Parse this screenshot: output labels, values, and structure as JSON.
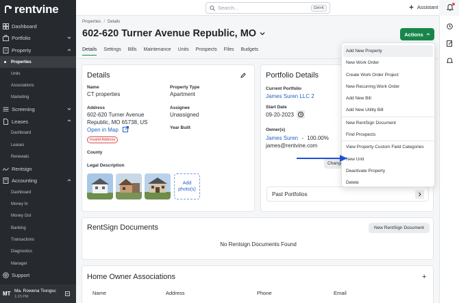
{
  "app": {
    "logo_text": "rentvine"
  },
  "sidebar": {
    "items": [
      {
        "label": "Dashboard",
        "icon": "dashboard-icon"
      },
      {
        "label": "Portfolio",
        "icon": "briefcase-icon"
      },
      {
        "label": "Property",
        "icon": "building-icon"
      },
      {
        "label": "Properties"
      },
      {
        "label": "Units"
      },
      {
        "label": "Associations"
      },
      {
        "label": "Marketing"
      },
      {
        "label": "Screening",
        "icon": "screening-icon"
      },
      {
        "label": "Leases",
        "icon": "document-icon"
      },
      {
        "label": "Dashboard"
      },
      {
        "label": "Leases"
      },
      {
        "label": "Renewals"
      },
      {
        "label": "Rentsign",
        "icon": "signature-icon"
      },
      {
        "label": "Accounting",
        "icon": "calculator-icon"
      },
      {
        "label": "Dashboard"
      },
      {
        "label": "Money In"
      },
      {
        "label": "Money Out"
      },
      {
        "label": "Banking"
      },
      {
        "label": "Transactions"
      },
      {
        "label": "Diagnostics"
      },
      {
        "label": "Manager"
      },
      {
        "label": "Support",
        "icon": "support-icon"
      }
    ],
    "user": {
      "initials": "MT",
      "name": "Ma. Rowena Tiongsc",
      "time": "1:23 PM"
    }
  },
  "topbar": {
    "search_placeholder": "Search...",
    "shortcut": "Ctrl+K",
    "assistant_label": "Assistant"
  },
  "breadcrumb": {
    "root": "Properties",
    "sep": "/",
    "current": "Details"
  },
  "page": {
    "title": "602-620 Turner Avenue Republic, MO",
    "actions_label": "Actions"
  },
  "tabs": [
    "Details",
    "Settings",
    "Bills",
    "Maintenance",
    "Units",
    "Prospects",
    "Files",
    "Budgets"
  ],
  "details": {
    "heading": "Details",
    "name_label": "Name",
    "name_value": "CT properties",
    "type_label": "Property Type",
    "type_value": "Apartment",
    "address_label": "Address",
    "address_line1": "602-620 Turner Avenue",
    "address_line2": "Republic, MO 65738, US",
    "map_link": "Open in Map",
    "invalid_badge": "Invalid Address",
    "assignee_label": "Assignee",
    "assignee_value": "Unassigned",
    "year_label": "Year Built",
    "county_label": "County",
    "legal_label": "Legal Description",
    "add_photo": "Add photo(s)"
  },
  "portfolio": {
    "heading": "Portfolio Details",
    "current_label": "Current Portfolio",
    "current_value": "James Suren LLC 2",
    "start_label": "Start Date",
    "start_value": "09-20-2023",
    "owners_label": "Owner(s)",
    "owner_name": "James Suren",
    "owner_dash": "-",
    "owner_pct": "100.00%",
    "owner_email": "james@rentvine.com",
    "change_label": "Change",
    "past_label": "Past Portfolios"
  },
  "rentsign": {
    "heading": "RentSign Documents",
    "button": "New RentSign Document",
    "empty": "No Rentsign Documents Found"
  },
  "hoa": {
    "heading": "Home Owner Associations",
    "add": "+",
    "columns": [
      "Name",
      "Address",
      "Phone",
      "Email"
    ]
  },
  "actions_menu": {
    "group1": [
      "Add New Property",
      "New Work Order",
      "Create Work Order Project",
      "New Recurring Work Order",
      "Add New Bill",
      "Add New Utility Bill"
    ],
    "group2": [
      "New RentSign Document",
      "Find Prospects"
    ],
    "group3": [
      "View Property Custom Field Categories",
      "New Unit",
      "Deactivate Property",
      "Delete"
    ]
  },
  "colors": {
    "accent": "#18864b",
    "link": "#2462c4",
    "sidebar": "#26292d",
    "annotation_arrow": "#1f4fd6"
  }
}
